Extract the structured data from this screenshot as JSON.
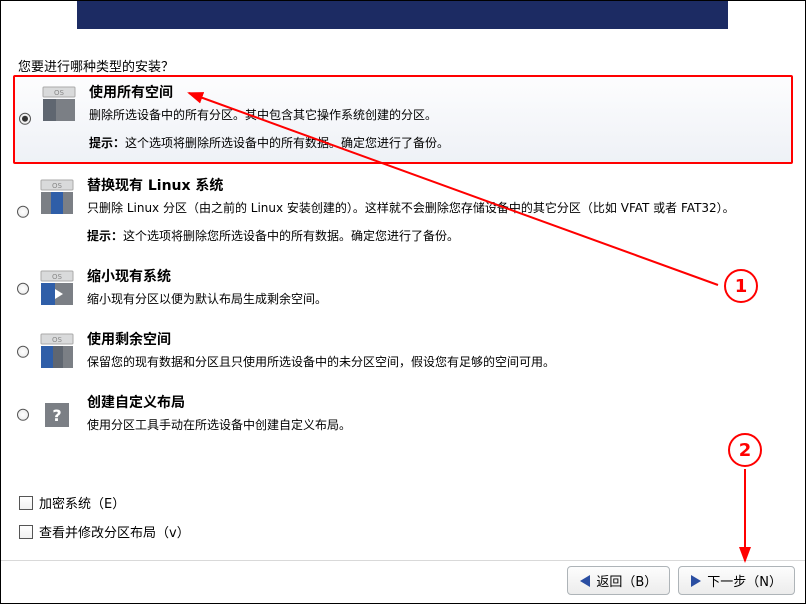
{
  "prompt": "您要进行哪种类型的安装？",
  "options": [
    {
      "title": "使用所有空间",
      "desc": "删除所选设备中的所有分区。其中包含其它操作系统创建的分区。",
      "hint_label": "提示：",
      "hint": "这个选项将删除所选设备中的所有数据。确定您进行了备份。",
      "selected": true,
      "icon": "disk-all"
    },
    {
      "title": "替换现有 Linux 系统",
      "desc": "只删除 Linux 分区（由之前的 Linux 安装创建的）。这样就不会删除您存储设备中的其它分区（比如 VFAT 或者 FAT32）。",
      "hint_label": "提示：",
      "hint": "这个选项将删除您所选设备中的所有数据。确定您进行了备份。",
      "selected": false,
      "icon": "disk-replace"
    },
    {
      "title": "缩小现有系统",
      "desc": "缩小现有分区以便为默认布局生成剩余空间。",
      "hint_label": "",
      "hint": "",
      "selected": false,
      "icon": "disk-shrink"
    },
    {
      "title": "使用剩余空间",
      "desc": "保留您的现有数据和分区且只使用所选设备中的未分区空间，假设您有足够的空间可用。",
      "hint_label": "",
      "hint": "",
      "selected": false,
      "icon": "disk-free"
    },
    {
      "title": "创建自定义布局",
      "desc": "使用分区工具手动在所选设备中创建自定义布局。",
      "hint_label": "",
      "hint": "",
      "selected": false,
      "icon": "disk-custom"
    }
  ],
  "checks": {
    "encrypt": "加密系统（E）",
    "review": "查看并修改分区布局（v）"
  },
  "buttons": {
    "back": "返回（B）",
    "next": "下一步（N）"
  },
  "annotations": {
    "one": "1",
    "two": "2"
  }
}
